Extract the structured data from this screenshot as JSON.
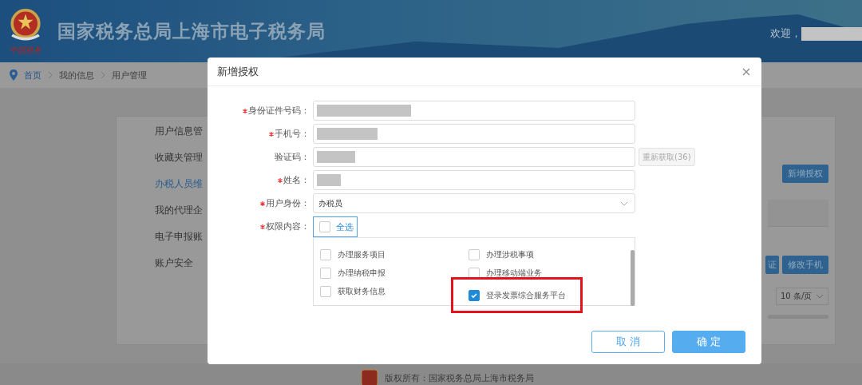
{
  "header": {
    "title": "国家税务总局上海市电子税务局",
    "logo_caption": "中国税务",
    "welcome": "欢迎，"
  },
  "breadcrumb": [
    {
      "label": "首页",
      "link": true
    },
    {
      "label": "我的信息",
      "link": false
    },
    {
      "label": "用户管理",
      "link": false
    }
  ],
  "sidebar": {
    "items": [
      {
        "label": "用户信息管",
        "selected": false
      },
      {
        "label": "收藏夹管理",
        "selected": false
      },
      {
        "label": "办税人员维",
        "selected": true
      },
      {
        "label": "我的代理企",
        "selected": false
      },
      {
        "label": "电子申报账",
        "selected": false
      },
      {
        "label": "账户安全",
        "selected": false
      }
    ]
  },
  "page_actions": {
    "add_button": "新增授权",
    "row_buttons": [
      "证",
      "修改手机"
    ],
    "page_size": "10 条/页"
  },
  "dialog": {
    "title": "新增授权",
    "fields": [
      {
        "label": "身份证件号码：",
        "required": true,
        "kind": "input",
        "redacted": true
      },
      {
        "label": "手机号：",
        "required": true,
        "kind": "input",
        "redacted": true
      },
      {
        "label": "验证码：",
        "required": false,
        "kind": "input",
        "redacted": true,
        "action": "重新获取(36)"
      },
      {
        "label": "姓名：",
        "required": true,
        "kind": "input",
        "redacted": true
      },
      {
        "label": "用户身份：",
        "required": true,
        "kind": "select",
        "value": "办税员"
      }
    ],
    "permissions": {
      "label": "权限内容：",
      "required": true,
      "select_all": {
        "label": "全选",
        "checked": false
      },
      "options": [
        {
          "label": "办理服务项目",
          "checked": false,
          "highlighted": false
        },
        {
          "label": "办理涉税事项",
          "checked": false,
          "highlighted": false
        },
        {
          "label": "办理纳税申报",
          "checked": false,
          "highlighted": false
        },
        {
          "label": "办理移动端业务",
          "checked": false,
          "highlighted": false
        },
        {
          "label": "获取财务信息",
          "checked": false,
          "highlighted": false
        },
        {
          "label": "登录发票综合服务平台",
          "checked": true,
          "highlighted": true
        }
      ]
    },
    "buttons": [
      {
        "label": "取 消",
        "kind": "secondary"
      },
      {
        "label": "确 定",
        "kind": "primary"
      }
    ]
  },
  "footer": {
    "copyright": "版权所有：国家税务总局上海市税务局"
  }
}
